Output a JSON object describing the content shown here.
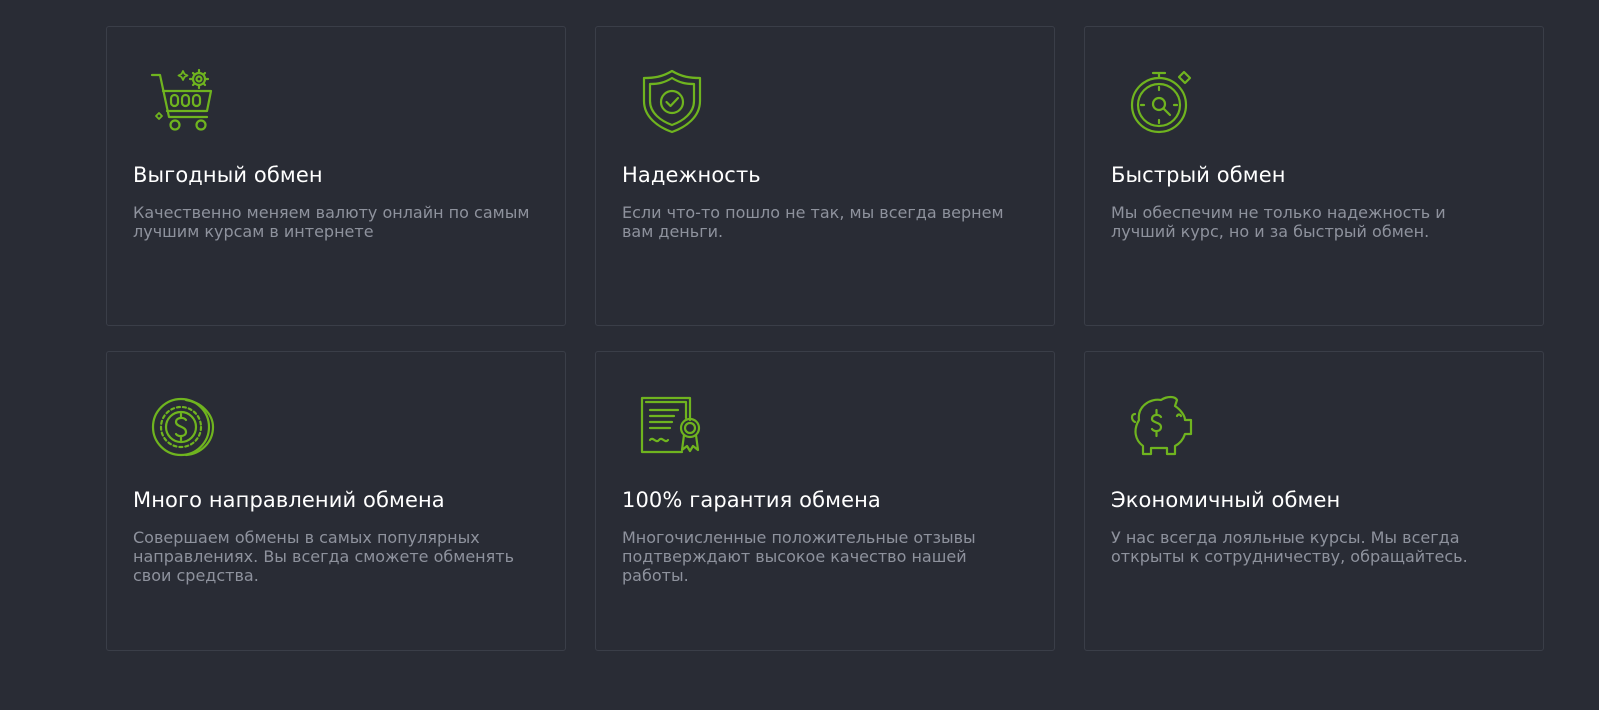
{
  "accent_color": "#6fb41f",
  "features": [
    {
      "icon": "shopping-cart-icon",
      "title": "Выгодный обмен",
      "description": "Качественно меняем валюту онлайн по самым лучшим курсам в интернете"
    },
    {
      "icon": "shield-check-icon",
      "title": "Надежность",
      "description": "Если что-то пошло не так, мы всегда вернем вам деньги."
    },
    {
      "icon": "stopwatch-icon",
      "title": "Быстрый обмен",
      "description": "Мы обеспечим не только надежность и лучший курс, но и за быстрый обмен."
    },
    {
      "icon": "dollar-coin-icon",
      "title": "Много направлений обмена",
      "description": "Совершаем обмены в самых популярных направлениях. Вы всегда сможете обменять свои средства."
    },
    {
      "icon": "certificate-icon",
      "title": "100% гарантия обмена",
      "description": "Многочисленные положительные отзывы подтверждают высокое качество нашей работы."
    },
    {
      "icon": "piggy-bank-icon",
      "title": "Экономичный обмен",
      "description": "У нас всегда лояльные курсы. Мы всегда открыты к сотрудничеству, обращайтесь."
    }
  ]
}
